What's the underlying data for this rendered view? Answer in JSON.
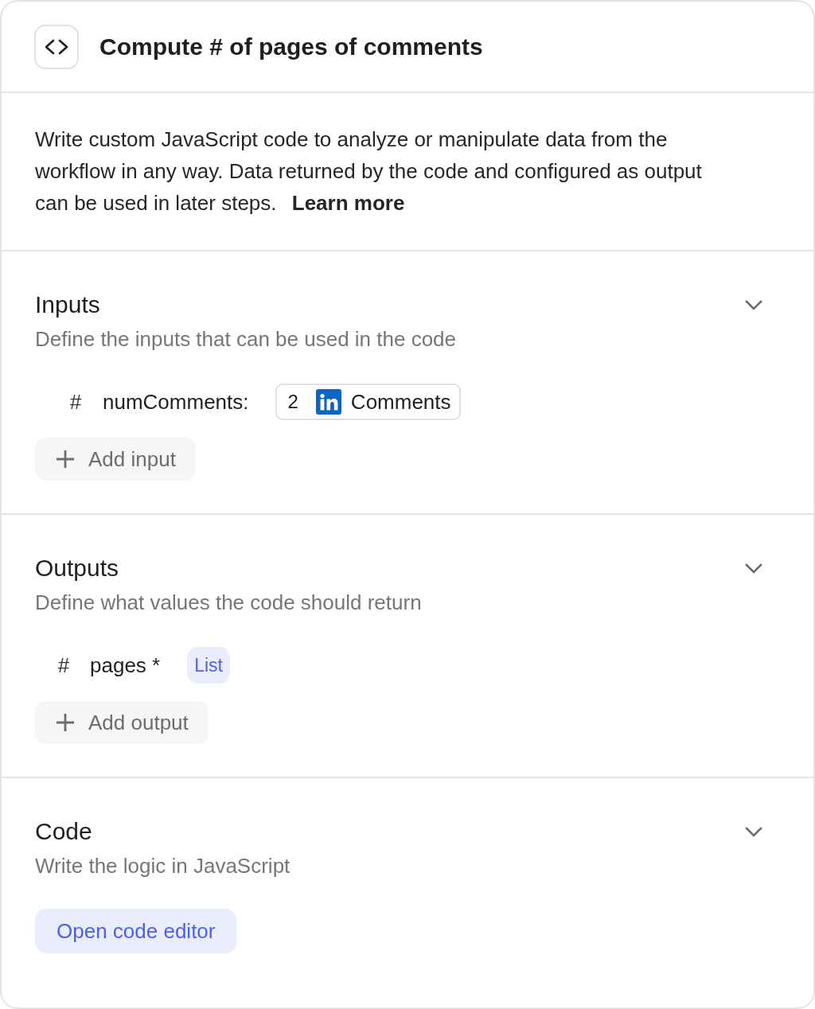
{
  "header": {
    "title": "Compute # of pages of comments"
  },
  "description": {
    "text": "Write custom JavaScript code to analyze or manipulate data from the workflow in any way. Data returned by the code and configured as output can be used in later steps.",
    "link": "Learn more"
  },
  "sections": [
    {
      "kind": "inputs",
      "title": "Inputs",
      "subtitle": "Define the inputs that can be used in the code",
      "expanded": true,
      "items": [
        {
          "kind": "input",
          "symbol": "#",
          "name": "numComments:",
          "value_number": "2",
          "value_label": "Comments"
        }
      ],
      "button": "Add input"
    },
    {
      "kind": "outputs",
      "title": "Outputs",
      "subtitle": "Define what values the code should return",
      "expanded": true,
      "items": [
        {
          "kind": "output",
          "symbol": "#",
          "name": "pages *",
          "type": "List"
        }
      ],
      "button": "Add output"
    },
    {
      "kind": "code",
      "title": "Code",
      "subtitle": "Write the logic in JavaScript",
      "expanded": true,
      "button": "Open code editor"
    }
  ]
}
